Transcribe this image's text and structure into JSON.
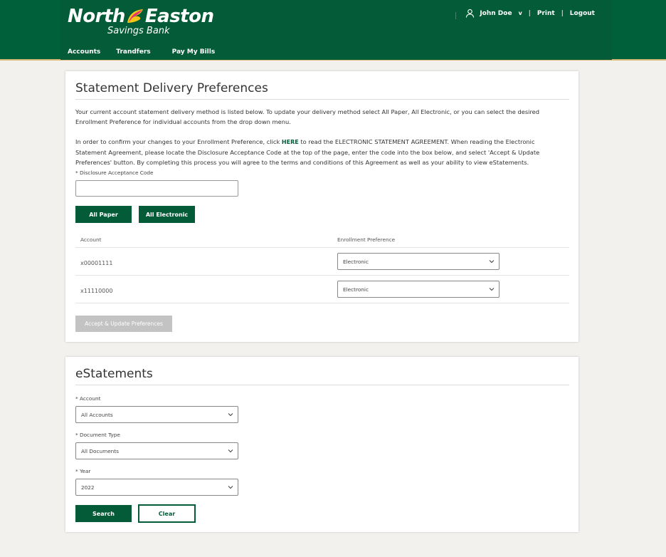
{
  "brand": {
    "name_left": "North",
    "name_right": "Easton",
    "tagline": "Savings Bank",
    "colors": {
      "primary": "#035c37",
      "header": "#00603a",
      "accent_leaf_pink": "#e8336b",
      "accent_leaf_yellow": "#f5c518"
    }
  },
  "nav": {
    "accounts": "Accounts",
    "transfers": "Trandfers",
    "bills": "Pay My Bills"
  },
  "user": {
    "name": "John Doe",
    "caret": "v",
    "sep1": "|",
    "print": "Print",
    "sep2": "|",
    "logout": "Logout"
  },
  "delivery": {
    "title": "Statement Delivery Preferences",
    "para1_line1": "Your current account statement delivery method is listed below. To update your delivery method select All Paper, All Electronic, or you can select the desired",
    "para1_line2": "Enrollment Preference for individual accounts from the drop down menu.",
    "para2_line1_a": "In order to confirm your changes to your Enrollment Preference, click",
    "para2_here": "HERE",
    "para2_line1_b": "to read the ELECTRONIC STATEMENT AGREEMENT. When reading the Electronic",
    "para2_line2": "Statement Agreement, please locate the Disclosure Acceptance Code at the top of the page, enter the code into the box below, and select 'Accept & Update",
    "para2_line3": "Preferences' button. By completing this process you will agree to the terms and conditions of this Agreement as well as your ability to view eStatements.",
    "code_label": "* Disclosure Acceptance Code",
    "code_value": "",
    "all_paper": "All Paper",
    "all_electronic": "All Electronic",
    "col_account": "Account",
    "col_pref": "Enrollment Preference",
    "rows": [
      {
        "account": "x00001111",
        "preference": "Electronic"
      },
      {
        "account": "x11110000",
        "preference": "Electronic"
      }
    ],
    "accept_button": "Accept & Update Preferences"
  },
  "estatements": {
    "title": "eStatements",
    "account_label": "* Account",
    "account_value": "All Accounts",
    "doctype_label": "* Document Type",
    "doctype_value": "All Documents",
    "year_label": "* Year",
    "year_value": "2022",
    "search": "Search",
    "clear": "Clear"
  }
}
